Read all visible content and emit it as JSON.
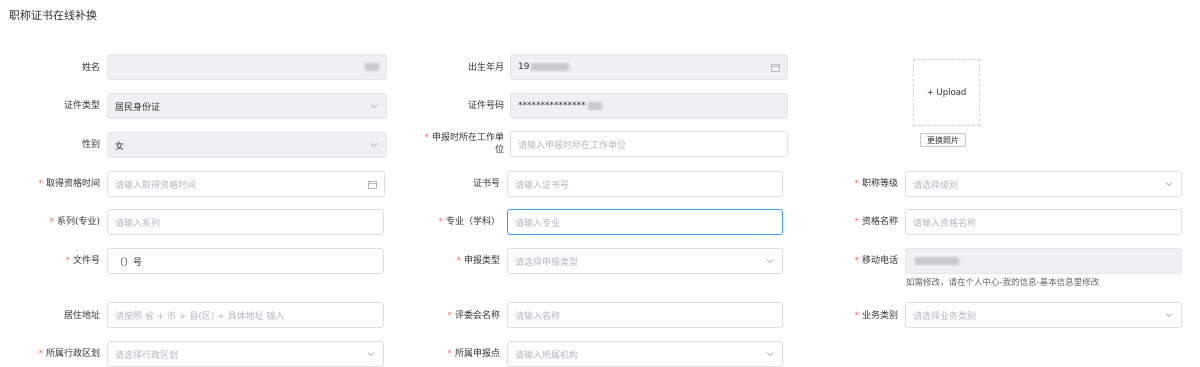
{
  "title": "职称证书在线补换",
  "fields": {
    "name": {
      "label": "姓名",
      "value": ""
    },
    "birth": {
      "label": "出生年月",
      "value": "19"
    },
    "id_type": {
      "label": "证件类型",
      "value": "居民身份证"
    },
    "id_no": {
      "label": "证件号码",
      "value": "***************"
    },
    "gender": {
      "label": "性别",
      "value": "女"
    },
    "work_unit": {
      "label_line1": "申报时所在工作单",
      "label_line2": "位",
      "placeholder": "请输入申报时所在工作单位"
    },
    "qual_time": {
      "label": "取得资格时间",
      "placeholder": "请输入取得资格时间"
    },
    "cert_no": {
      "label": "证书号",
      "placeholder": "请输入证书号"
    },
    "title_level": {
      "label": "职称等级",
      "placeholder": "请选择级别"
    },
    "series": {
      "label": "系列(专业)",
      "placeholder": "请输入系列"
    },
    "major": {
      "label": "专业（学科）",
      "placeholder": "请输入专业"
    },
    "qual_name": {
      "label": "资格名称",
      "placeholder": "请输入资格名称"
    },
    "doc_no": {
      "label": "文件号",
      "value": "〔〕号"
    },
    "apply_type": {
      "label": "申报类型",
      "placeholder": "请选择申报类型"
    },
    "mobile": {
      "label": "移动电话",
      "value": "",
      "hint": "如需修改，请在个人中心-我的信息-基本信息里修改"
    },
    "address": {
      "label": "居住地址",
      "placeholder": "请按照 省 + 市 + 县(区) + 具体地址 输入"
    },
    "committee": {
      "label": "评委会名称",
      "placeholder": "请输入名称"
    },
    "biz_type": {
      "label": "业务类别",
      "placeholder": "请选择业务类别"
    },
    "district": {
      "label": "所属行政区划",
      "placeholder": "请选择行政区划"
    },
    "apply_point": {
      "label": "所属申报点",
      "placeholder": "请输入所属机构"
    }
  },
  "photo": {
    "upload_label": "+ Upload",
    "change_button": "更换照片"
  },
  "icons": {
    "calendar": "calendar-icon",
    "chevron": "chevron-down-icon"
  },
  "colors": {
    "required": "#f56c6c",
    "focus": "#409eff",
    "disabled_bg": "#f0f0f2"
  }
}
